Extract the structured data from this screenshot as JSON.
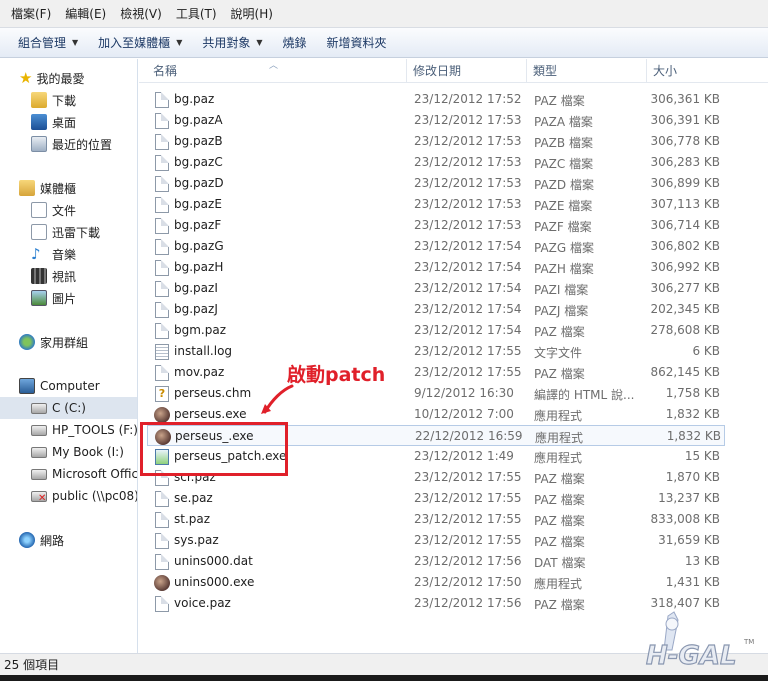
{
  "menubar": {
    "items": [
      "檔案(F)",
      "編輯(E)",
      "檢視(V)",
      "工具(T)",
      "說明(H)"
    ]
  },
  "commandbar": {
    "organize": "組合管理",
    "include_library": "加入至媒體櫃",
    "share": "共用對象",
    "burn": "燒錄",
    "new_folder": "新增資料夾"
  },
  "nav": {
    "favorites": "我的最愛",
    "downloads": "下載",
    "desktop": "桌面",
    "recent": "最近的位置",
    "libraries": "媒體櫃",
    "documents": "文件",
    "thunder": "迅雷下載",
    "music": "音樂",
    "videos": "視訊",
    "pictures": "圖片",
    "homegroup": "家用群組",
    "computer": "Computer",
    "drive_c": "C (C:)",
    "drive_f": "HP_TOOLS (F:)",
    "drive_i": "My Book (I:)",
    "drive_office": "Microsoft Offic",
    "drive_public": "public (\\\\pc08)",
    "network": "網路"
  },
  "columns": {
    "name": "名稱",
    "date": "修改日期",
    "type": "類型",
    "size": "大小"
  },
  "files": [
    {
      "name": "bg.paz",
      "date": "23/12/2012 17:52",
      "type": "PAZ 檔案",
      "size": "306,361 KB",
      "icon": "doc"
    },
    {
      "name": "bg.pazA",
      "date": "23/12/2012 17:53",
      "type": "PAZA 檔案",
      "size": "306,391 KB",
      "icon": "doc"
    },
    {
      "name": "bg.pazB",
      "date": "23/12/2012 17:53",
      "type": "PAZB 檔案",
      "size": "306,778 KB",
      "icon": "doc"
    },
    {
      "name": "bg.pazC",
      "date": "23/12/2012 17:53",
      "type": "PAZC 檔案",
      "size": "306,283 KB",
      "icon": "doc"
    },
    {
      "name": "bg.pazD",
      "date": "23/12/2012 17:53",
      "type": "PAZD 檔案",
      "size": "306,899 KB",
      "icon": "doc"
    },
    {
      "name": "bg.pazE",
      "date": "23/12/2012 17:53",
      "type": "PAZE 檔案",
      "size": "307,113 KB",
      "icon": "doc"
    },
    {
      "name": "bg.pazF",
      "date": "23/12/2012 17:53",
      "type": "PAZF 檔案",
      "size": "306,714 KB",
      "icon": "doc"
    },
    {
      "name": "bg.pazG",
      "date": "23/12/2012 17:54",
      "type": "PAZG 檔案",
      "size": "306,802 KB",
      "icon": "doc"
    },
    {
      "name": "bg.pazH",
      "date": "23/12/2012 17:54",
      "type": "PAZH 檔案",
      "size": "306,992 KB",
      "icon": "doc"
    },
    {
      "name": "bg.pazI",
      "date": "23/12/2012 17:54",
      "type": "PAZI 檔案",
      "size": "306,277 KB",
      "icon": "doc"
    },
    {
      "name": "bg.pazJ",
      "date": "23/12/2012 17:54",
      "type": "PAZJ 檔案",
      "size": "202,345 KB",
      "icon": "doc"
    },
    {
      "name": "bgm.paz",
      "date": "23/12/2012 17:54",
      "type": "PAZ 檔案",
      "size": "278,608 KB",
      "icon": "doc"
    },
    {
      "name": "install.log",
      "date": "23/12/2012 17:55",
      "type": "文字文件",
      "size": "6 KB",
      "icon": "log"
    },
    {
      "name": "mov.paz",
      "date": "23/12/2012 17:55",
      "type": "PAZ 檔案",
      "size": "862,145 KB",
      "icon": "doc"
    },
    {
      "name": "perseus.chm",
      "date": "9/12/2012 16:30",
      "type": "編譯的 HTML 說...",
      "size": "1,758 KB",
      "icon": "chm"
    },
    {
      "name": "perseus.exe",
      "date": "10/12/2012 7:00",
      "type": "應用程式",
      "size": "1,832 KB",
      "icon": "exe"
    },
    {
      "name": "perseus_.exe",
      "date": "22/12/2012 16:59",
      "type": "應用程式",
      "size": "1,832 KB",
      "icon": "exe"
    },
    {
      "name": "perseus_patch.exe",
      "date": "23/12/2012 1:49",
      "type": "應用程式",
      "size": "15 KB",
      "icon": "patch"
    },
    {
      "name": "scr.paz",
      "date": "23/12/2012 17:55",
      "type": "PAZ 檔案",
      "size": "1,870 KB",
      "icon": "doc"
    },
    {
      "name": "se.paz",
      "date": "23/12/2012 17:55",
      "type": "PAZ 檔案",
      "size": "13,237 KB",
      "icon": "doc"
    },
    {
      "name": "st.paz",
      "date": "23/12/2012 17:55",
      "type": "PAZ 檔案",
      "size": "833,008 KB",
      "icon": "doc"
    },
    {
      "name": "sys.paz",
      "date": "23/12/2012 17:55",
      "type": "PAZ 檔案",
      "size": "31,659 KB",
      "icon": "doc"
    },
    {
      "name": "unins000.dat",
      "date": "23/12/2012 17:56",
      "type": "DAT 檔案",
      "size": "13 KB",
      "icon": "doc"
    },
    {
      "name": "unins000.exe",
      "date": "23/12/2012 17:50",
      "type": "應用程式",
      "size": "1,431 KB",
      "icon": "exe"
    },
    {
      "name": "voice.paz",
      "date": "23/12/2012 17:56",
      "type": "PAZ 檔案",
      "size": "318,407 KB",
      "icon": "doc"
    }
  ],
  "highlighted_index": 16,
  "annotation": "啟動patch",
  "status": "25 個項目",
  "watermark": "H-GAL",
  "watermark_tm": "TM",
  "colors": {
    "annotation_red": "#e0202a",
    "nav_selected": "#dde5ef",
    "command_text": "#1e3a66"
  }
}
